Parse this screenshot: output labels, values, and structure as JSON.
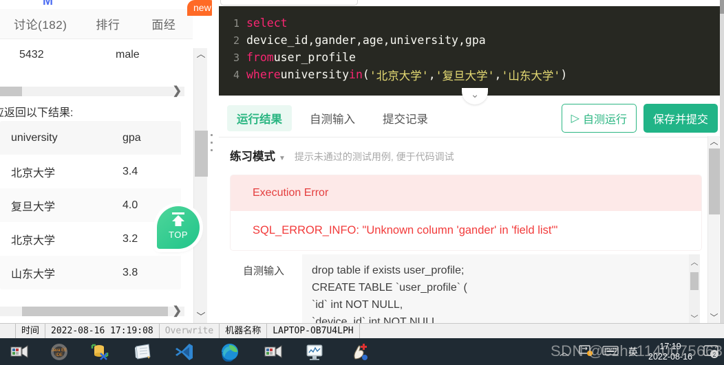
{
  "left_panel": {
    "tabs": [
      {
        "label": ")",
        "name": "tab-partial"
      },
      {
        "label": "讨论(182)",
        "name": "tab-discussion"
      },
      {
        "label": "排行",
        "name": "tab-ranking"
      },
      {
        "label": "面经",
        "name": "tab-interview"
      }
    ],
    "new_badge": "new",
    "partial_glyph": "M",
    "top_table": {
      "id_value": "5432",
      "gender_value": "male"
    },
    "result_note": "应返回以下结果:",
    "result_table": {
      "columns": [
        "university",
        "gpa"
      ],
      "rows": [
        {
          "university": "北京大学",
          "gpa": "3.4"
        },
        {
          "university": "复旦大学",
          "gpa": "4.0"
        },
        {
          "university": "北京大学",
          "gpa": "3.2"
        },
        {
          "university": "山东大学",
          "gpa": "3.8"
        }
      ]
    },
    "top_button": {
      "label": "TOP"
    },
    "scroll_arrow_right": "❯",
    "scroll_arrow_up": "︿",
    "scroll_arrow_down": "﹀"
  },
  "editor": {
    "theme_bg": "#272822",
    "keyword_color": "#f92672",
    "string_color": "#e6db74",
    "lines": [
      {
        "num": "1",
        "tokens": [
          {
            "t": "select",
            "c": "kw"
          }
        ]
      },
      {
        "num": "2",
        "tokens": [
          {
            "t": "device_id,gander,age,university,gpa",
            "c": "pl"
          }
        ]
      },
      {
        "num": "3",
        "tokens": [
          {
            "t": "from",
            "c": "kw"
          },
          {
            "t": " user_profile",
            "c": "pl"
          }
        ]
      },
      {
        "num": "4",
        "tokens": [
          {
            "t": "where",
            "c": "kw"
          },
          {
            "t": " university ",
            "c": "pl"
          },
          {
            "t": "in",
            "c": "kw"
          },
          {
            "t": "(",
            "c": "pn"
          },
          {
            "t": "'北京大学'",
            "c": "str"
          },
          {
            "t": ",",
            "c": "pn"
          },
          {
            "t": "'复旦大学'",
            "c": "str"
          },
          {
            "t": ",",
            "c": "pn"
          },
          {
            "t": "'山东大学'",
            "c": "str"
          },
          {
            "t": ")",
            "c": "pn"
          }
        ]
      }
    ],
    "collapse_icon": "⌄"
  },
  "toolbar": {
    "tabs": [
      {
        "label": "运行结果",
        "active": true
      },
      {
        "label": "自测输入",
        "active": false
      },
      {
        "label": "提交记录",
        "active": false
      }
    ],
    "run_label": "自测运行",
    "run_icon": "▷",
    "submit_label": "保存并提交",
    "accent_color": "#21b487"
  },
  "result": {
    "mode_label": "练习模式",
    "mode_caret": "▼",
    "mode_hint": "提示未通过的测试用例, 便于代码调试",
    "error_title": "Execution Error",
    "error_detail": "SQL_ERROR_INFO: \"Unknown column 'gander' in 'field list'\"",
    "error_color": "#f23b3b",
    "error_bg": "#fde9e8"
  },
  "selftest": {
    "label": "自测输入",
    "lines": [
      "drop table if exists user_profile;",
      "CREATE TABLE `user_profile` (",
      "`id` int NOT NULL,",
      "`device_id` int NOT NULL,"
    ]
  },
  "statusbar": {
    "time_label": "时间",
    "time_value": "2022-08-16 17:19:08",
    "overwrite": "Overwrite",
    "machine_label": "机器名称",
    "machine_value": "LAPTOP-OB7U4LPH"
  },
  "taskbar": {
    "icons": [
      "screen-recorder-icon",
      "java-ee-ide-icon",
      "database-tool-icon",
      "notepad-icon",
      "vscode-icon",
      "edge-icon",
      "screen-recorder-2-icon",
      "monitor-icon",
      "security-icon"
    ],
    "tray": {
      "chevron": "︿",
      "network_icon": "network-icon",
      "keyboard_icon": "keyboard-icon",
      "ime_label": "英",
      "clock_time": "17:19",
      "clock_date": "2022-08-16",
      "notification_count": "2"
    }
  },
  "watermark": "SDN @czhc1140075663"
}
